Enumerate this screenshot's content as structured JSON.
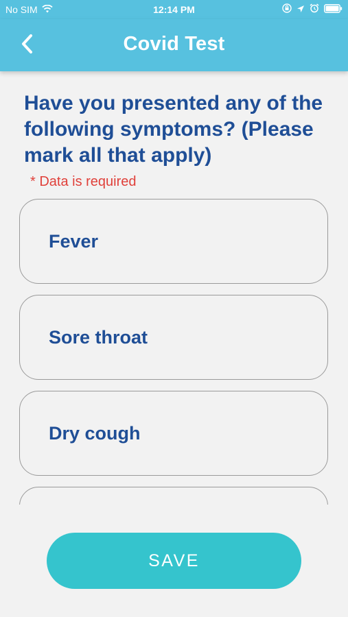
{
  "status_bar": {
    "carrier": "No SIM",
    "time": "12:14 PM",
    "icons": [
      "wifi-icon",
      "orientation-lock-icon",
      "location-arrow-icon",
      "alarm-clock-icon",
      "battery-icon"
    ]
  },
  "nav": {
    "title": "Covid Test",
    "back_icon": "chevron-left-icon"
  },
  "question": {
    "text": "Have you presented any of the following symptoms? (Please mark all that apply)",
    "required_note": "* Data is required"
  },
  "options": [
    {
      "label": "Fever"
    },
    {
      "label": "Sore throat"
    },
    {
      "label": "Dry cough"
    },
    {
      "label": ""
    }
  ],
  "save_label": "SAVE",
  "colors": {
    "header": "#57c1df",
    "question_text": "#1f4e96",
    "required_text": "#e0403a",
    "save_button": "#35c4cd",
    "background": "#f2f2f2"
  }
}
